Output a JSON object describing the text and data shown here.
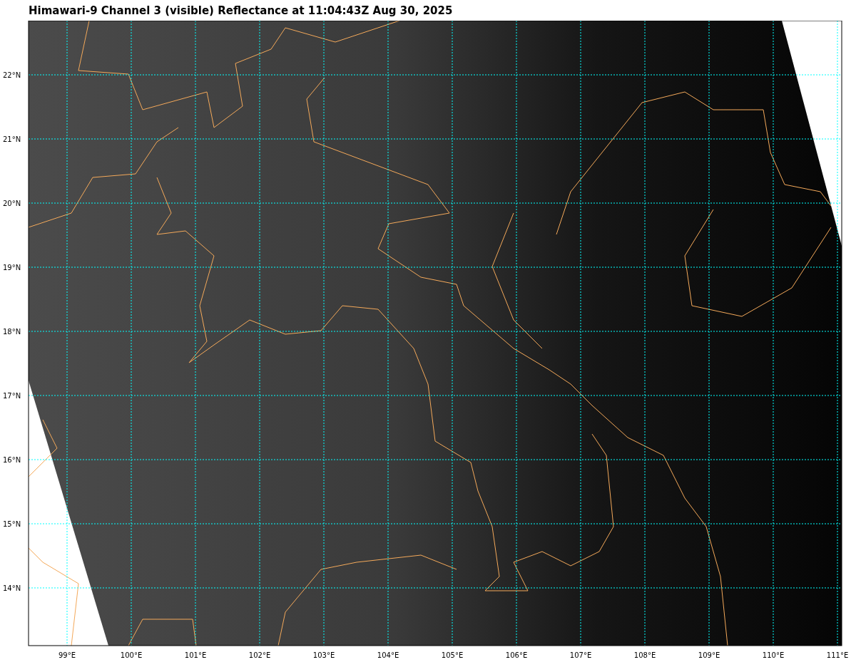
{
  "title": "Himawari-9 Channel 3 (visible) Reflectance at 11:04:43Z Aug 30, 2025",
  "map": {
    "lat_labels": [
      "22°N",
      "21°N",
      "20°N",
      "19°N",
      "18°N",
      "17°N",
      "16°N",
      "15°N",
      "14°N"
    ],
    "lon_labels": [
      "99°E",
      "100°E",
      "101°E",
      "102°E",
      "103°E",
      "104°E",
      "105°E",
      "106°E",
      "107°E",
      "108°E",
      "109°E",
      "110°E",
      "111°E"
    ]
  }
}
